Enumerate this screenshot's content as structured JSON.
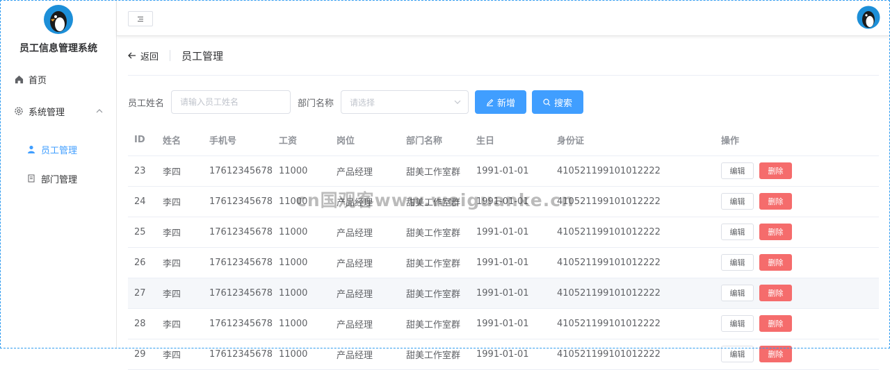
{
  "app": {
    "title": "员工信息管理系统"
  },
  "sidebar": {
    "items": [
      {
        "label": "首页",
        "icon": "home-icon"
      },
      {
        "label": "系统管理",
        "icon": "gear-icon",
        "expanded": true
      },
      {
        "label": "员工管理",
        "icon": "user-icon",
        "active": true
      },
      {
        "label": "部门管理",
        "icon": "document-icon"
      }
    ]
  },
  "header": {
    "back_label": "返回",
    "page_title": "员工管理"
  },
  "search": {
    "name_label": "员工姓名",
    "name_placeholder": "请输入员工姓名",
    "dept_label": "部门名称",
    "dept_placeholder": "请选择",
    "add_label": "新增",
    "search_label": "搜索"
  },
  "table": {
    "columns": [
      "ID",
      "姓名",
      "手机号",
      "工资",
      "岗位",
      "部门名称",
      "生日",
      "身份证",
      "操作"
    ],
    "edit_label": "编辑",
    "delete_label": "删除",
    "rows": [
      [
        "23",
        "李四",
        "17612345678",
        "11000",
        "产品经理",
        "甜美工作室群",
        "1991-01-01",
        "410521199101012222"
      ],
      [
        "24",
        "李四",
        "17612345678",
        "11000",
        "产品经理",
        "甜美工作室群",
        "1991-01-01",
        "410521199101012222"
      ],
      [
        "25",
        "李四",
        "17612345678",
        "11000",
        "产品经理",
        "甜美工作室群",
        "1991-01-01",
        "410521199101012222"
      ],
      [
        "26",
        "李四",
        "17612345678",
        "11000",
        "产品经理",
        "甜美工作室群",
        "1991-01-01",
        "410521199101012222"
      ],
      [
        "27",
        "李四",
        "17612345678",
        "11000",
        "产品经理",
        "甜美工作室群",
        "1991-01-01",
        "410521199101012222"
      ],
      [
        "28",
        "李四",
        "17612345678",
        "11000",
        "产品经理",
        "甜美工作室群",
        "1991-01-01",
        "410521199101012222"
      ],
      [
        "29",
        "李四",
        "17612345678",
        "11000",
        "产品经理",
        "甜美工作室群",
        "1991-01-01",
        "410521199101012222"
      ]
    ]
  },
  "watermark": "cn国观客www.weiguanke.cn",
  "colors": {
    "primary": "#409eff",
    "danger": "#f56c6c",
    "frame": "#2e9bf0"
  }
}
